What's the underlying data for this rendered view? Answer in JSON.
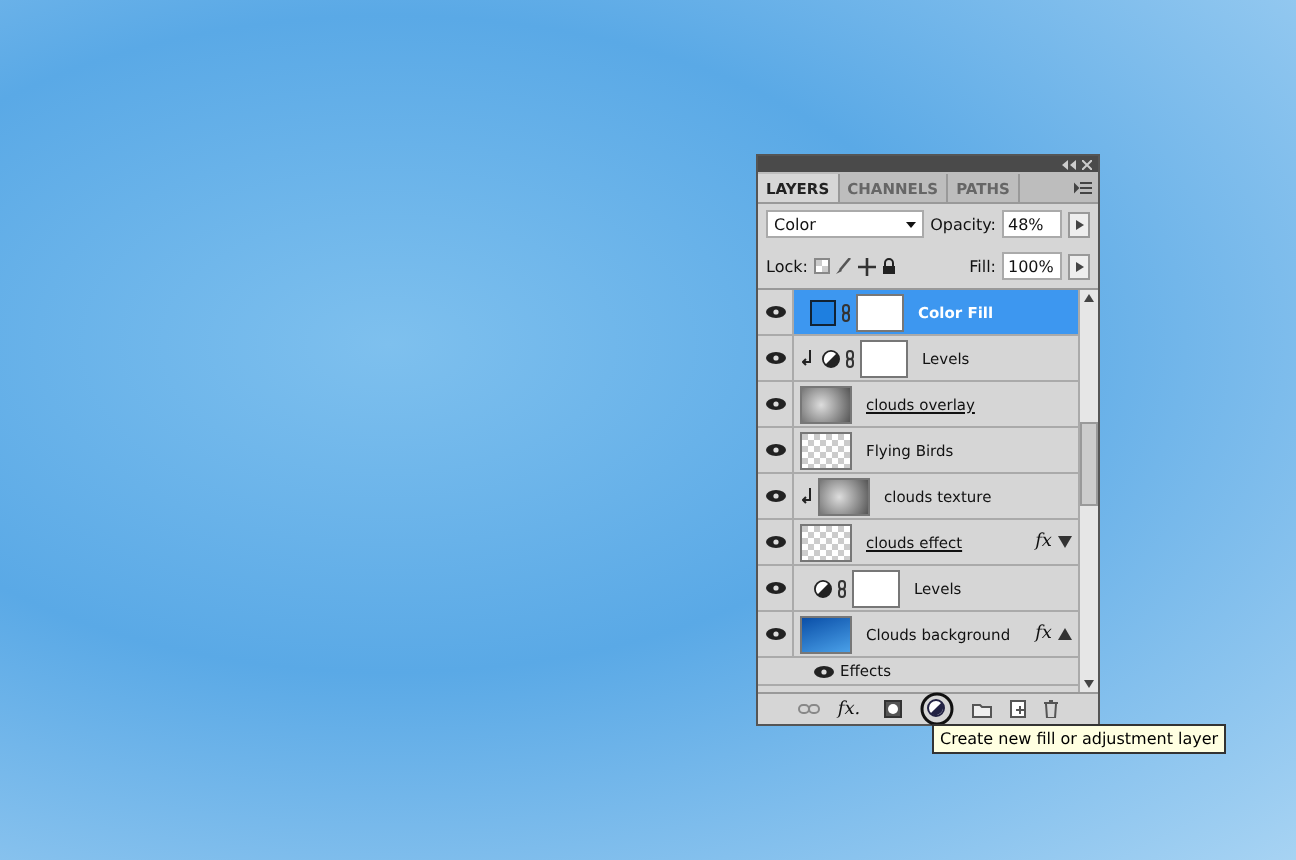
{
  "panel": {
    "tabs": [
      {
        "label": "LAYERS",
        "selected": true
      },
      {
        "label": "CHANNELS",
        "selected": false
      },
      {
        "label": "PATHS",
        "selected": false
      }
    ],
    "blend_mode": "Color",
    "opacity_label": "Opacity:",
    "opacity": "48%",
    "lock_label": "Lock:",
    "fill_label": "Fill:",
    "fill": "100%",
    "layers": [
      {
        "kind": "fill",
        "name": "Color Fill",
        "selected": true,
        "visible": true,
        "clipped": false,
        "underlined": false
      },
      {
        "kind": "adjustment",
        "name": "Levels",
        "selected": false,
        "visible": true,
        "clipped": true,
        "underlined": false
      },
      {
        "kind": "image",
        "name": "clouds overlay",
        "selected": false,
        "visible": true,
        "clipped": false,
        "underlined": true
      },
      {
        "kind": "transparent",
        "name": "Flying Birds",
        "selected": false,
        "visible": true,
        "clipped": false,
        "underlined": false
      },
      {
        "kind": "image",
        "name": "clouds texture",
        "selected": false,
        "visible": true,
        "clipped": true,
        "underlined": false
      },
      {
        "kind": "smart",
        "name": "clouds effect",
        "effect_badge": "fx",
        "selected": false,
        "visible": true,
        "clipped": false,
        "underlined": true,
        "expanded": false
      },
      {
        "kind": "adjustment",
        "name": "Levels",
        "selected": false,
        "visible": true,
        "clipped": false,
        "underlined": false
      },
      {
        "kind": "sky",
        "name": "Clouds background",
        "effect_badge": "fx",
        "selected": false,
        "visible": true,
        "clipped": false,
        "underlined": false,
        "expanded": true
      },
      {
        "kind": "effects",
        "name": "Effects",
        "selected": false,
        "visible": true,
        "clipped": false,
        "underlined": false
      }
    ],
    "fx_button": "fx."
  },
  "tooltip": "Create new fill or adjustment layer"
}
